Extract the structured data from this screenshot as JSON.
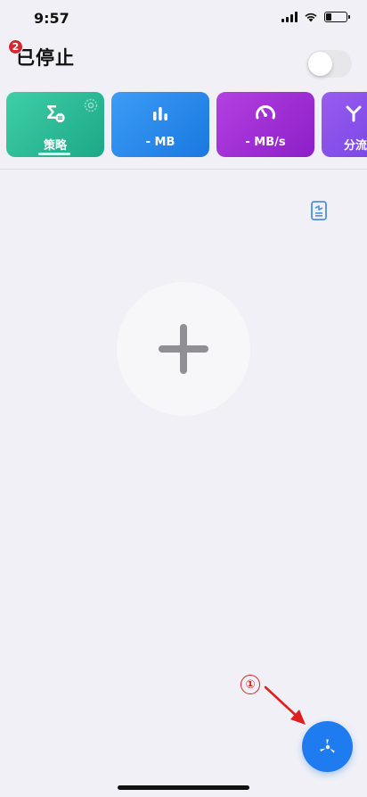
{
  "status_bar": {
    "time": "9:57",
    "battery_level": 0.25
  },
  "header": {
    "title": "已停止",
    "badge_count": "2",
    "toggle_on": false
  },
  "cards": [
    {
      "label": "策略",
      "icon": "strategy-sigma-icon",
      "selected": true
    },
    {
      "label": "- MB",
      "icon": "bar-chart-icon"
    },
    {
      "label": "- MB/s",
      "icon": "speedometer-icon"
    },
    {
      "label": "分流",
      "icon": "split-icon"
    }
  ],
  "annotation": {
    "step_label": "①"
  },
  "colors": {
    "strategy_card": "#1ba887",
    "traffic_card": "#1a78e0",
    "speed_card": "#8c1fc8",
    "split_card": "#6c3fe0",
    "fab": "#1f7cf0",
    "badge": "#d8262f",
    "annotation": "#dd2222"
  }
}
